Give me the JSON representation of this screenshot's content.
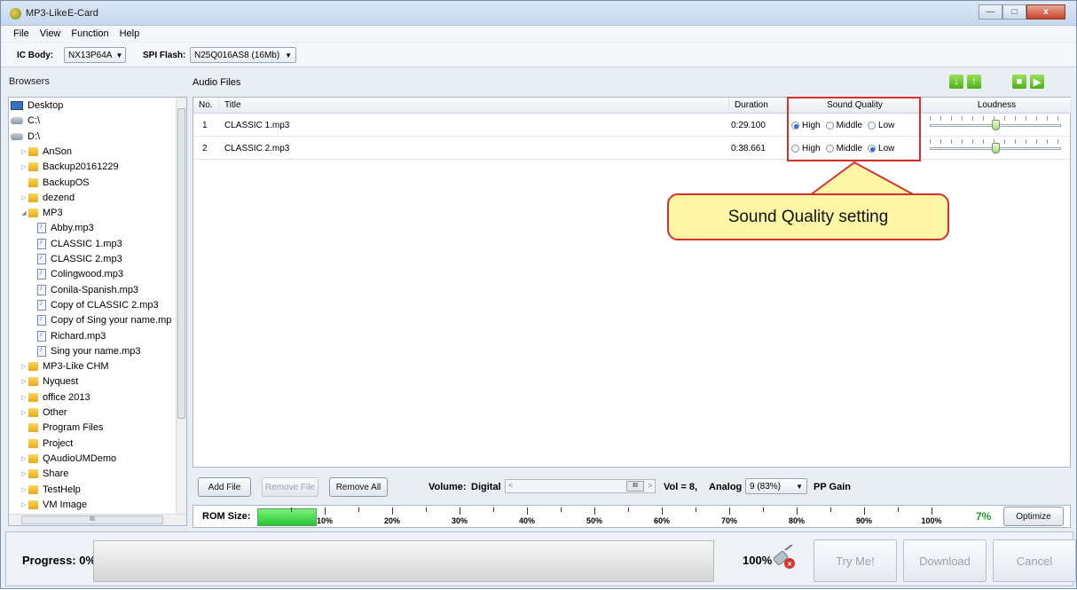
{
  "window": {
    "app_title": "MP3-Like",
    "card_title": "E-Card",
    "buttons": [
      "—",
      "□",
      "x"
    ]
  },
  "menu": [
    "File",
    "View",
    "Function",
    "Help"
  ],
  "toolbar": {
    "ic_body_label": "IC Body:",
    "ic_body_value": "NX13P64A",
    "spi_label": "SPI Flash:",
    "spi_value": "N25Q016AS8 (16Mb)"
  },
  "browsers": {
    "title": "Browsers",
    "items": [
      {
        "label": "Desktop",
        "type": "desktop",
        "indent": 0,
        "expand": ""
      },
      {
        "label": "C:\\",
        "type": "drive",
        "indent": 0,
        "expand": ""
      },
      {
        "label": "D:\\",
        "type": "drive",
        "indent": 0,
        "expand": ""
      },
      {
        "label": "AnSon",
        "type": "folder",
        "indent": 1,
        "expand": "▷"
      },
      {
        "label": "Backup20161229",
        "type": "folder",
        "indent": 1,
        "expand": "▷"
      },
      {
        "label": "BackupOS",
        "type": "folder",
        "indent": 1,
        "expand": ""
      },
      {
        "label": "dezend",
        "type": "folder",
        "indent": 1,
        "expand": "▷"
      },
      {
        "label": "MP3",
        "type": "folder",
        "indent": 1,
        "expand": "◢"
      },
      {
        "label": "Abby.mp3",
        "type": "file",
        "indent": 2,
        "expand": ""
      },
      {
        "label": "CLASSIC 1.mp3",
        "type": "file",
        "indent": 2,
        "expand": ""
      },
      {
        "label": "CLASSIC 2.mp3",
        "type": "file",
        "indent": 2,
        "expand": ""
      },
      {
        "label": "Colingwood.mp3",
        "type": "file",
        "indent": 2,
        "expand": ""
      },
      {
        "label": "Conila-Spanish.mp3",
        "type": "file",
        "indent": 2,
        "expand": ""
      },
      {
        "label": "Copy of CLASSIC 2.mp3",
        "type": "file",
        "indent": 2,
        "expand": ""
      },
      {
        "label": "Copy of Sing your name.mp",
        "type": "file",
        "indent": 2,
        "expand": ""
      },
      {
        "label": "Richard.mp3",
        "type": "file",
        "indent": 2,
        "expand": ""
      },
      {
        "label": "Sing your name.mp3",
        "type": "file",
        "indent": 2,
        "expand": ""
      },
      {
        "label": "MP3-Like CHM",
        "type": "folder",
        "indent": 1,
        "expand": "▷"
      },
      {
        "label": "Nyquest",
        "type": "folder",
        "indent": 1,
        "expand": "▷"
      },
      {
        "label": "office 2013",
        "type": "folder",
        "indent": 1,
        "expand": "▷"
      },
      {
        "label": "Other",
        "type": "folder",
        "indent": 1,
        "expand": "▷"
      },
      {
        "label": "Program Files",
        "type": "folder",
        "indent": 1,
        "expand": ""
      },
      {
        "label": "Project",
        "type": "folder",
        "indent": 1,
        "expand": ""
      },
      {
        "label": "QAudioUMDemo",
        "type": "folder",
        "indent": 1,
        "expand": "▷"
      },
      {
        "label": "Share",
        "type": "folder",
        "indent": 1,
        "expand": "▷"
      },
      {
        "label": "TestHelp",
        "type": "folder",
        "indent": 1,
        "expand": "▷"
      },
      {
        "label": "VM Image",
        "type": "folder",
        "indent": 1,
        "expand": "▷"
      }
    ],
    "hscroll_label": "III"
  },
  "audio": {
    "title": "Audio Files",
    "columns": {
      "no": "No.",
      "title": "Title",
      "duration": "Duration",
      "quality": "Sound Quality",
      "loudness": "Loudness"
    },
    "quality_options": [
      "High",
      "Middle",
      "Low"
    ],
    "rows": [
      {
        "no": "1",
        "title": "CLASSIC 1.mp3",
        "duration": "0:29.100",
        "quality": "High",
        "loudness_fraction": 0.5
      },
      {
        "no": "2",
        "title": "CLASSIC 2.mp3",
        "duration": "0:38.661",
        "quality": "Low",
        "loudness_fraction": 0.5
      }
    ]
  },
  "callout": "Sound Quality setting",
  "controls": {
    "add_file": "Add File",
    "remove_file": "Remove File",
    "remove_all": "Remove All",
    "volume_label": "Volume:",
    "digital_label": "Digital",
    "slider_center": "III",
    "vol_text": "Vol = 8,",
    "analog_label": "Analog",
    "analog_value": "9 (83%)",
    "pp_gain": "PP Gain"
  },
  "rom": {
    "label": "ROM Size:",
    "used_percent": 7,
    "used_text": "7%",
    "scale": [
      "10%",
      "20%",
      "30%",
      "40%",
      "50%",
      "60%",
      "70%",
      "80%",
      "90%",
      "100%"
    ],
    "optimize": "Optimize"
  },
  "progress": {
    "label": "Progress:  0%",
    "percent_text": "100%",
    "try_me": "Try Me!",
    "download": "Download",
    "cancel": "Cancel"
  },
  "colors": {
    "accent_green": "#4bb21a",
    "highlight_red": "#d5322e",
    "callout_fill": "#fdf6a4"
  }
}
